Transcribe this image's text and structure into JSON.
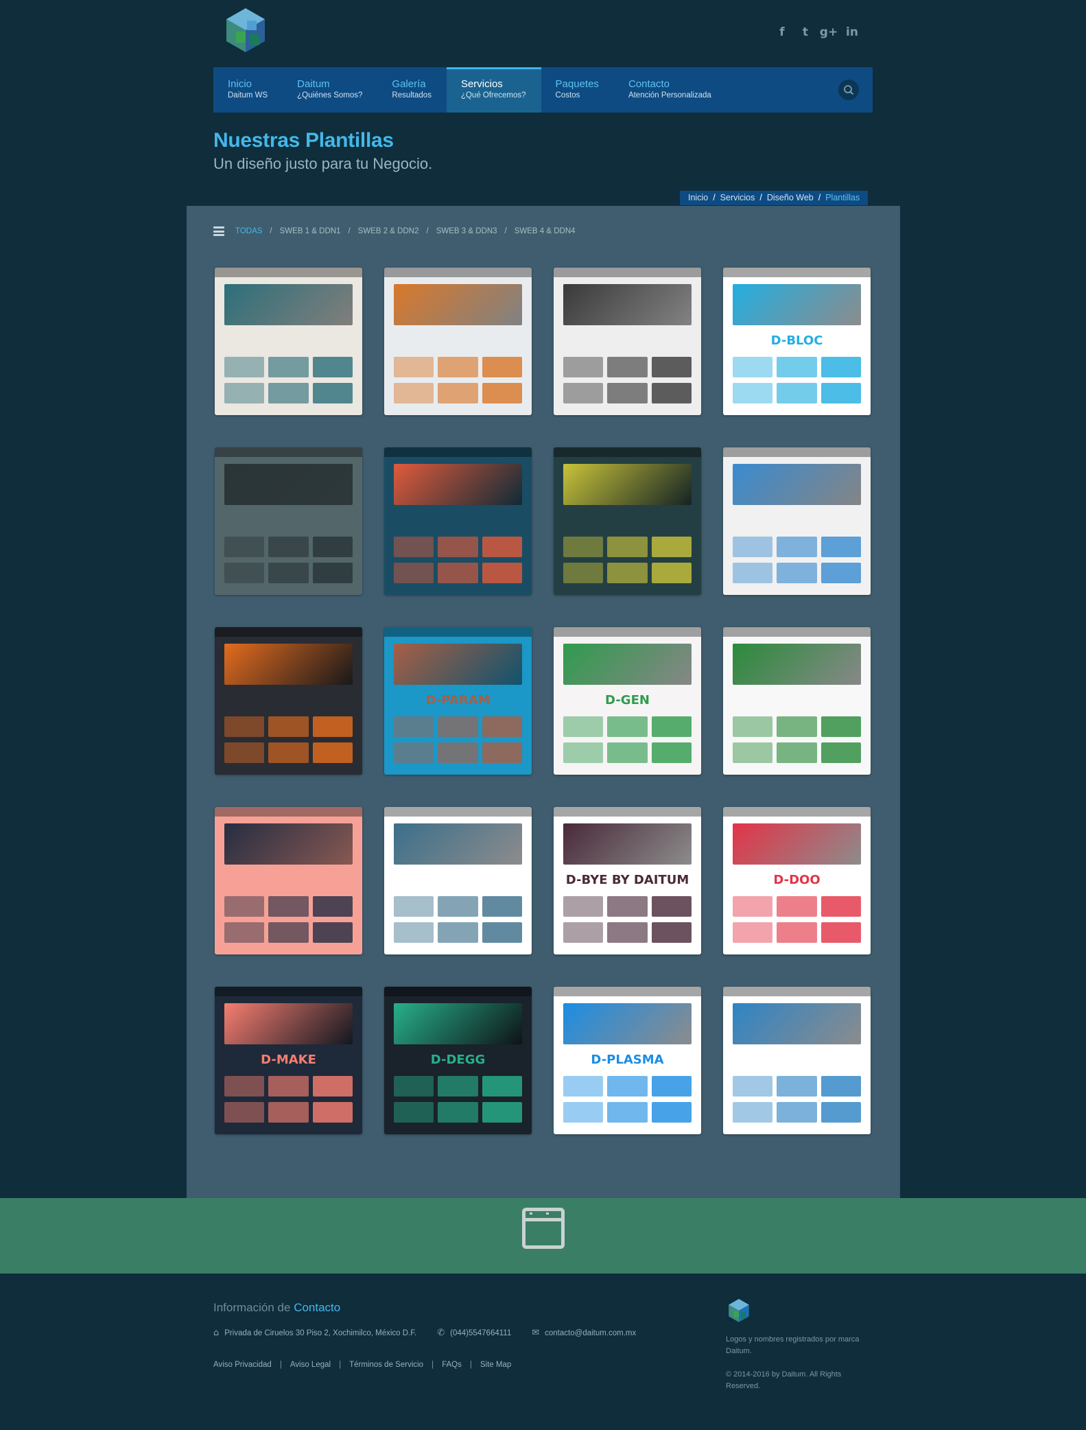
{
  "header": {
    "social": [
      "f",
      "t",
      "g+",
      "in"
    ],
    "social_icons": [
      "facebook-icon",
      "twitter-icon",
      "google-plus-icon",
      "linkedin-icon"
    ]
  },
  "nav": {
    "items": [
      {
        "title": "Inicio",
        "sub": "Daitum WS"
      },
      {
        "title": "Daitum",
        "sub": "¿Quiénes Somos?"
      },
      {
        "title": "Galería",
        "sub": "Resultados"
      },
      {
        "title": "Servicios",
        "sub": "¿Qué Ofrecemos?"
      },
      {
        "title": "Paquetes",
        "sub": "Costos"
      },
      {
        "title": "Contacto",
        "sub": "Atención Personalizada"
      }
    ],
    "active_index": 3
  },
  "page": {
    "title": "Nuestras Plantillas",
    "subtitle": "Un diseño justo para tu Negocio."
  },
  "breadcrumb": [
    "Inicio",
    "Servicios",
    "Diseño Web",
    "Plantillas"
  ],
  "filters": [
    "TODAS",
    "SWEB 1 & DDN1",
    "SWEB 2 & DDN2",
    "SWEB 3 & DDN3",
    "SWEB 4 & DDN4"
  ],
  "templates": [
    {
      "name": "",
      "bg": "#ebe7e1",
      "accent": "#2d6f7a"
    },
    {
      "name": "",
      "bg": "#e8ecef",
      "accent": "#d9782b"
    },
    {
      "name": "",
      "bg": "#eeeeee",
      "accent": "#3a3a3a"
    },
    {
      "name": "D-BLOC",
      "bg": "#ffffff",
      "accent": "#23aee0"
    },
    {
      "name": "",
      "bg": "#53666a",
      "accent": "#2a3537"
    },
    {
      "name": "",
      "bg": "#1a4d63",
      "accent": "#e05a3c"
    },
    {
      "name": "",
      "bg": "#243f43",
      "accent": "#c9c33a"
    },
    {
      "name": "",
      "bg": "#f1f1f1",
      "accent": "#3a8bd0"
    },
    {
      "name": "",
      "bg": "#2a2c33",
      "accent": "#e46c1e"
    },
    {
      "name": "D-PARAM",
      "bg": "#1b97c8",
      "accent": "#a85f45"
    },
    {
      "name": "D-GEN",
      "bg": "#f6f4f4",
      "accent": "#2f9b4e"
    },
    {
      "name": "",
      "bg": "#f8f8f8",
      "accent": "#2a8b3b"
    },
    {
      "name": "",
      "bg": "#f7a196",
      "accent": "#262d42"
    },
    {
      "name": "",
      "bg": "#ffffff",
      "accent": "#3c6f8b"
    },
    {
      "name": "D-BYE BY DAITUM",
      "bg": "#ffffff",
      "accent": "#4a2a3a"
    },
    {
      "name": "D-DOO",
      "bg": "#ffffff",
      "accent": "#e33448"
    },
    {
      "name": "D-MAKE",
      "bg": "#1e2a3a",
      "accent": "#f77e70"
    },
    {
      "name": "D-DEGG",
      "bg": "#1a222b",
      "accent": "#28b08a"
    },
    {
      "name": "D-PLASMA",
      "bg": "#ffffff",
      "accent": "#1c8de3"
    },
    {
      "name": "",
      "bg": "#ffffff",
      "accent": "#2e84c5"
    }
  ],
  "footer": {
    "title_prefix": "Información de ",
    "title_accent": "Contacto",
    "address": "Privada de Ciruelos 30 Piso 2, Xochimilco, México D.F.",
    "phone": "(044)5547664111",
    "email": "contacto@daitum.com.mx",
    "links": [
      "Aviso Privacidad",
      "Aviso Legal",
      "Términos de Servicio",
      "FAQs",
      "Site Map"
    ],
    "legal": "Logos y nombres registrados por marca Daitum.",
    "copyright": "© 2014-2016 by Daitum. All Rights Reserved."
  },
  "colors": {
    "background": "#0f2d3b",
    "nav": "#0e4b83",
    "accent": "#43b8ea",
    "panel": "#3f5d6e",
    "strip": "#3b7e66"
  }
}
